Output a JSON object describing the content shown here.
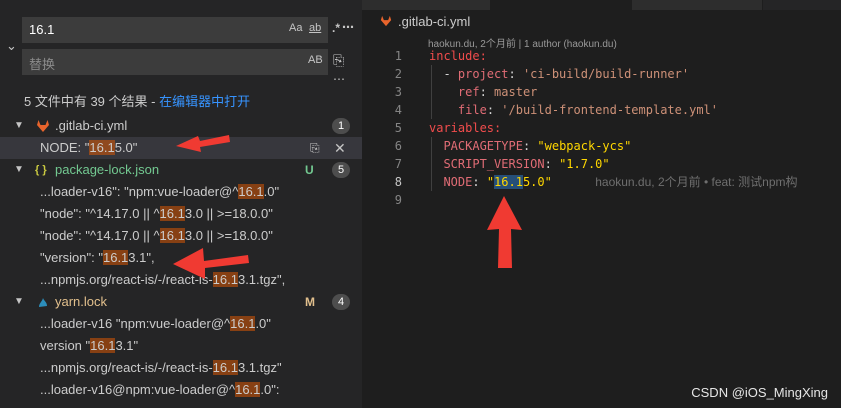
{
  "search": {
    "query": "16.1",
    "opt_case": "Aa",
    "opt_word": "ab",
    "opt_regex": ".*",
    "replace_placeholder": "替换",
    "opt_preserve": "AB"
  },
  "summary": {
    "text": "5 文件中有 39 个结果 - ",
    "link": "在编辑器中打开"
  },
  "results": {
    "gitlab": {
      "name": ".gitlab-ci.yml",
      "count": "1",
      "m1": {
        "pre": "NODE: \"",
        "hl": "16.1",
        "post": "5.0\""
      }
    },
    "pkg": {
      "name": "package-lock.json",
      "status": "U",
      "count": "5",
      "m1": {
        "pre": "...loader-v16\": \"npm:vue-loader@^",
        "hl": "16.1",
        "post": ".0\""
      },
      "m2": {
        "pre": "\"node\": \"^14.17.0 || ^",
        "hl": "16.1",
        "post": "3.0 || >=18.0.0\""
      },
      "m3": {
        "pre": "\"node\": \"^14.17.0 || ^",
        "hl": "16.1",
        "post": "3.0 || >=18.0.0\""
      },
      "m4": {
        "pre": "\"version\": \"",
        "hl": "16.1",
        "post": "3.1\","
      },
      "m5": {
        "pre": "...npmjs.org/react-is/-/react-is-",
        "hl": "16.1",
        "post": "3.1.tgz\","
      }
    },
    "yarn": {
      "name": "yarn.lock",
      "status": "M",
      "count": "4",
      "m1": {
        "pre": "...loader-v16 \"npm:vue-loader@^",
        "hl": "16.1",
        "post": ".0\""
      },
      "m2": {
        "pre": "version \"",
        "hl": "16.1",
        "post": "3.1\""
      },
      "m3": {
        "pre": "...npmjs.org/react-is/-/react-is-",
        "hl": "16.1",
        "post": "3.1.tgz\""
      },
      "m4": {
        "pre": "...loader-v16@npm:vue-loader@^",
        "hl": "16.1",
        "post": ".0\":"
      }
    }
  },
  "editor": {
    "breadcrumb": ".gitlab-ci.yml",
    "blame_header": "haokun.du, 2个月前 | 1 author (haokun.du)",
    "lines": {
      "l1": "include:",
      "l2_key": "project",
      "l2_val": "'ci-build/build-runner'",
      "l3_key": "ref",
      "l3_val": "master",
      "l4_key": "file",
      "l4_val": "'/build-frontend-template.yml'",
      "l5": "variables:",
      "l6_key": "PACKAGETYPE",
      "l6_val": "\"webpack-ycs\"",
      "l7_key": "SCRIPT_VERSION",
      "l7_val": "\"1.7.0\"",
      "l8_key": "NODE",
      "l8_q": "\"",
      "l8_sel": "16.1",
      "l8_rest": "5.0\"",
      "l8_blame": "haokun.du, 2个月前 • feat: 测试npm构"
    },
    "line_numbers": [
      "1",
      "2",
      "3",
      "4",
      "5",
      "6",
      "7",
      "8",
      "9"
    ]
  },
  "watermark": "CSDN @iOS_MingXing",
  "colors": {
    "accent_link": "#3794ff",
    "match_highlight": "#ea5c00",
    "arrow": "#f03a32",
    "untracked": "#73c991",
    "modified": "#e2c08d"
  },
  "icons": {
    "gitlab": "gitlab-icon",
    "json": "json-braces-icon",
    "yarn": "yarn-icon"
  }
}
